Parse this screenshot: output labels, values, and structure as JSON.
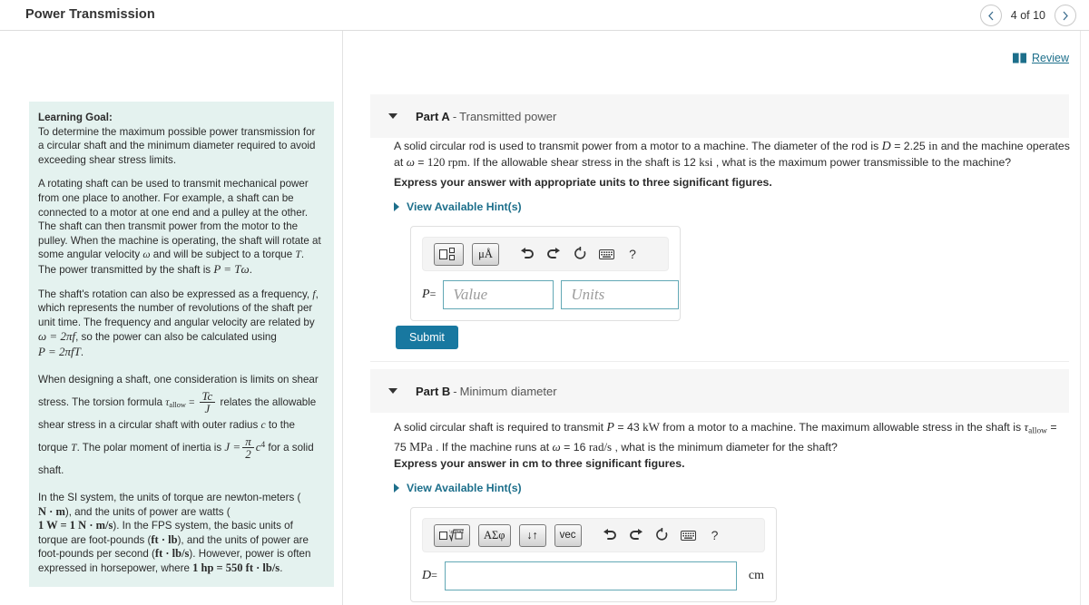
{
  "header": {
    "title": "Power Transmission",
    "pager": {
      "prev_icon": "chevron-left-icon",
      "next_icon": "chevron-right-icon",
      "label": "4 of 10"
    }
  },
  "review": {
    "icon": "book-icon",
    "label": "Review",
    "color": "#1d6f8b"
  },
  "learning_goal": {
    "heading": "Learning Goal:",
    "goal_text": "To determine the maximum possible power transmission for a circular shaft and the minimum diameter required to avoid exceeding shear stress limits.",
    "paragraph_2_a": "A rotating shaft can be used to transmit mechanical power from one place to another. For example, a shaft can be connected to a motor at one end and a pulley at the other. The shaft can then transmit power from the motor to the pulley. When the machine is operating, the shaft will rotate at some angular velocity ",
    "omega": "ω",
    "paragraph_2_b": " and will be subject to a torque ",
    "torque_T": "T",
    "paragraph_2_c": ". The power transmitted by the shaft is ",
    "power_eq": "P = Tω",
    "paragraph_2_d": ".",
    "paragraph_3_a": "The shaft's rotation can also be expressed as a frequency, ",
    "freq_f": "f",
    "paragraph_3_b": ", which represents the number of revolutions of the shaft per unit time. The frequency and angular velocity are related by ",
    "omega_eq": "ω = 2πf",
    "paragraph_3_c": ", so the power can also be calculated using ",
    "power_freq_eq": "P = 2πfT",
    "paragraph_3_d": ".",
    "paragraph_4_a": "When designing a shaft, one consideration is limits on shear stress. The torsion formula ",
    "tau_symbol": "τ",
    "tau_sub": "allow",
    "equals": "=",
    "frac_num": "Tc",
    "frac_den": "J",
    "paragraph_4_b": " relates the allowable shear stress in a circular shaft with outer radius ",
    "radius_c": "c",
    "paragraph_4_c": " to the torque ",
    "torque_T2": "T",
    "paragraph_4_d": ". The polar moment of inertia is ",
    "J_eq": "J =",
    "pi_num": "π",
    "two_den": "2",
    "c4": "c",
    "c4_sup": "4",
    "paragraph_4_e": " for a solid shaft.",
    "paragraph_5_a": "In the SI system, the units of torque are newton-meters (",
    "nm": "N · m",
    "paragraph_5_b": "), and the units of power are watts (",
    "watt_eq": "1 W = 1 N · m/s",
    "paragraph_5_c": "). In the FPS system, the basic units of torque are foot-pounds (",
    "ftlb": "ft · lb",
    "paragraph_5_d": "), and the units of power are foot-pounds per second (",
    "ftlbs": "ft · lb/s",
    "paragraph_5_e": "). However, power is often expressed in horsepower, where ",
    "hp_eq": "1 hp = 550 ft · lb/s",
    "paragraph_5_f": "."
  },
  "part_a": {
    "caret_icon": "caret-down-icon",
    "name": "Part A",
    "dash": "-",
    "subtitle": "Transmitted power",
    "prompt_a": "A solid circular rod is used to transmit power from a motor to a machine. The diameter of the rod is ",
    "D_symbol": "D",
    "prompt_b": " = 2.25 ",
    "in_unit": "in",
    "prompt_c": " and the machine operates at ",
    "omega_symbol": "ω",
    "prompt_d": " = ",
    "rpm_value": "120 rpm",
    "prompt_e": ". If the allowable shear stress in the shaft is 12 ",
    "ksi_unit": "ksi",
    "prompt_f": " , what is the maximum power transmissible to the machine?",
    "express": "Express your answer with appropriate units to three significant figures.",
    "hints_icon": "caret-right-icon",
    "hints_label": "View Available Hint(s)",
    "toolbar": [
      {
        "kind": "key",
        "icon": "template-matrix-icon",
        "label": ""
      },
      {
        "kind": "key",
        "icon": "units-mu-angstrom-icon",
        "label": "μÅ"
      },
      {
        "kind": "icon",
        "icon": "undo-icon",
        "label": "↶"
      },
      {
        "kind": "icon",
        "icon": "redo-icon",
        "label": "↷"
      },
      {
        "kind": "icon",
        "icon": "reset-icon",
        "label": "↺"
      },
      {
        "kind": "icon",
        "icon": "keyboard-icon",
        "label": "⌨"
      },
      {
        "kind": "icon",
        "icon": "help-icon",
        "label": "?"
      }
    ],
    "var_label": "P",
    "var_eq": "=",
    "value_placeholder": "Value",
    "value_current": "",
    "units_placeholder": "Units",
    "units_current": "",
    "submit_label": "Submit"
  },
  "part_b": {
    "caret_icon": "caret-down-icon",
    "name": "Part B",
    "dash": "-",
    "subtitle": "Minimum diameter",
    "prompt_a": "A solid circular shaft is required to transmit ",
    "P_symbol": "P",
    "prompt_b": " = 43 ",
    "kW_unit": "kW",
    "prompt_c": " from a motor to a machine. The maximum allowable stress in the shaft is ",
    "tau_symbol": "τ",
    "tau_sub": "allow",
    "prompt_d": " = 75 ",
    "MPa_unit": "MPa",
    "prompt_e": " . If the machine runs at ",
    "omega_symbol": "ω",
    "prompt_f": " = 16 ",
    "rad_unit": "rad/s",
    "prompt_g": " , what is the minimum diameter for the shaft?",
    "express": "Express your answer in cm to three significant figures.",
    "hints_icon": "caret-right-icon",
    "hints_label": "View Available Hint(s)",
    "toolbar": [
      {
        "kind": "key",
        "icon": "template-radical-icon",
        "label": ""
      },
      {
        "kind": "key",
        "icon": "greek-letters-icon",
        "label": "ΑΣφ"
      },
      {
        "kind": "key",
        "icon": "arrows-updown-icon",
        "label": "↓↑"
      },
      {
        "kind": "key",
        "icon": "vector-icon",
        "label": "vec"
      },
      {
        "kind": "icon",
        "icon": "undo-icon",
        "label": "↶"
      },
      {
        "kind": "icon",
        "icon": "redo-icon",
        "label": "↷"
      },
      {
        "kind": "icon",
        "icon": "reset-icon",
        "label": "↺"
      },
      {
        "kind": "icon",
        "icon": "keyboard-icon",
        "label": "⌨"
      },
      {
        "kind": "icon",
        "icon": "help-icon",
        "label": "?"
      }
    ],
    "var_label": "D",
    "var_eq": "=",
    "value_current": "",
    "unit_suffix": "cm"
  }
}
